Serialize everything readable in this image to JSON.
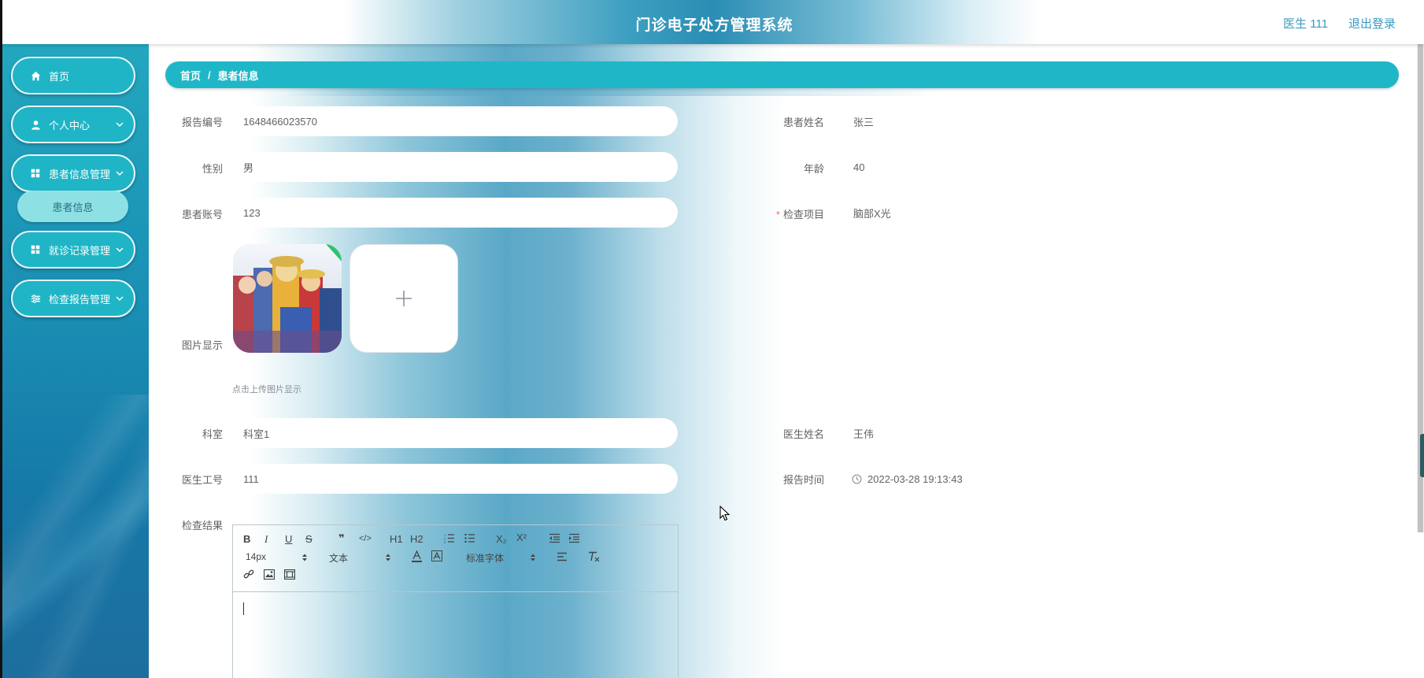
{
  "header": {
    "title": "门诊电子处方管理系统",
    "user": "医生 111",
    "logout": "退出登录"
  },
  "sidebar": {
    "items": [
      {
        "label": "首页",
        "icon": "home-icon"
      },
      {
        "label": "个人中心",
        "icon": "user-icon"
      },
      {
        "label": "患者信息管理",
        "icon": "grid-icon"
      },
      {
        "label": "就诊记录管理",
        "icon": "grid-icon"
      },
      {
        "label": "检查报告管理",
        "icon": "sliders-icon"
      }
    ],
    "submenu": [
      "患者信息"
    ]
  },
  "breadcrumb": {
    "home": "首页",
    "separator": "/",
    "current": "患者信息"
  },
  "form": {
    "report_no": {
      "label": "报告编号",
      "value": "1648466023570"
    },
    "patient_name": {
      "label": "患者姓名",
      "value": "张三"
    },
    "gender": {
      "label": "性别",
      "value": "男"
    },
    "age": {
      "label": "年龄",
      "value": "40"
    },
    "patient_account": {
      "label": "患者账号",
      "value": "123"
    },
    "exam_item": {
      "label": "检查项目",
      "value": "脑部X光",
      "required": "*"
    },
    "image": {
      "label": "图片显示",
      "hint": "点击上传图片显示"
    },
    "department": {
      "label": "科室",
      "value": "科室1"
    },
    "doctor_name": {
      "label": "医生姓名",
      "value": "王伟"
    },
    "doctor_id": {
      "label": "医生工号",
      "value": "111"
    },
    "report_time": {
      "label": "报告时间",
      "value": "2022-03-28 19:13:43"
    },
    "exam_result": {
      "label": "检查结果"
    }
  },
  "editor": {
    "font_size": "14px",
    "block_format": "文本",
    "font_family": "标准字体",
    "buttons": [
      "B",
      "I",
      "U",
      "S",
      "❞",
      "</>",
      "H1",
      "H2",
      "ordered-list",
      "bullet-list",
      "X₂",
      "X²",
      "outdent",
      "indent"
    ]
  },
  "colors": {
    "accent": "#1fb7c7",
    "sidebar": "#1a90b4",
    "required": "#f56c6c",
    "header_text": "#3a9ac0"
  }
}
